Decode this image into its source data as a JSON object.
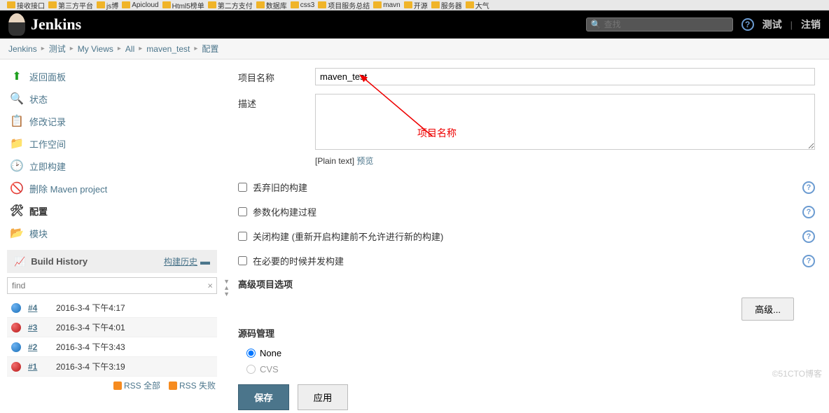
{
  "bookmarks": [
    "接收接口",
    "第三方平台",
    "js博",
    "Apicloud",
    "Html5榜单",
    "第二方支付",
    "数据库",
    "css3",
    "项目服务总结",
    "mavn",
    "开源",
    "服务器",
    "大气"
  ],
  "header": {
    "title": "Jenkins",
    "search_placeholder": "查找",
    "link_test": "测试",
    "link_logout": "注销"
  },
  "breadcrumb": [
    "Jenkins",
    "测试",
    "My Views",
    "All",
    "maven_test",
    "配置"
  ],
  "sidebar": {
    "items": [
      {
        "label": "返回面板",
        "icon": "▲",
        "color": "#1fa01f"
      },
      {
        "label": "状态",
        "icon": "🔍",
        "color": "#888"
      },
      {
        "label": "修改记录",
        "icon": "📄",
        "color": "#d6a83f"
      },
      {
        "label": "工作空间",
        "icon": "📁",
        "color": "#5a8ecb"
      },
      {
        "label": "立即构建",
        "icon": "⟳",
        "color": "#3fa03f"
      },
      {
        "label": "删除 Maven project",
        "icon": "⊘",
        "color": "#d33"
      },
      {
        "label": "配置",
        "icon": "🛠",
        "color": "#666",
        "active": true
      },
      {
        "label": "模块",
        "icon": "📂",
        "color": "#d6a83f"
      }
    ],
    "build_history_title": "Build History",
    "build_history_link": "构建历史",
    "find_placeholder": "find",
    "builds": [
      {
        "num": "#4",
        "date": "2016-3-4 下午4:17",
        "status": "blue"
      },
      {
        "num": "#3",
        "date": "2016-3-4 下午4:01",
        "status": "red"
      },
      {
        "num": "#2",
        "date": "2016-3-4 下午3:43",
        "status": "blue"
      },
      {
        "num": "#1",
        "date": "2016-3-4 下午3:19",
        "status": "red"
      }
    ],
    "rss_all": "RSS 全部",
    "rss_fail": "RSS 失败"
  },
  "form": {
    "project_name_label": "项目名称",
    "project_name_value": "maven_test",
    "description_label": "描述",
    "description_value": "",
    "plain_text": "[Plain text]",
    "preview": "预览",
    "discard_old": "丢弃旧的构建",
    "parameterized": "参数化构建过程",
    "disable_build": "关闭构建 (重新开启构建前不允许进行新的构建)",
    "concurrent": "在必要的时候并发构建",
    "adv_options_header": "高级项目选项",
    "adv_button": "高级...",
    "scm_header": "源码管理",
    "scm_none": "None",
    "scm_cvs": "CVS",
    "save": "保存",
    "apply": "应用"
  },
  "annotation": "项目名称",
  "watermark": "©51CTO博客"
}
